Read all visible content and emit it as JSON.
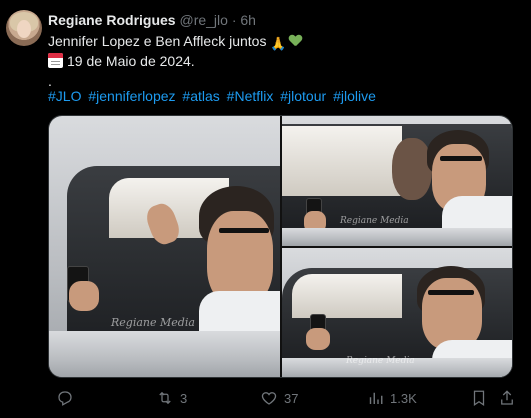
{
  "tweet": {
    "author_name": "Regiane Rodrigues",
    "handle": "@re_jlo",
    "separator": "·",
    "time": "6h",
    "line1": "Jennifer Lopez e Ben Affleck juntos",
    "line1_emoji_pray": "🙏",
    "line2": "19 de Maio de 2024.",
    "line3": ".",
    "hashtags": [
      "#JLO",
      "#jenniferlopez",
      "#atlas",
      "#Netflix",
      "#jlotour",
      "#jlolive"
    ],
    "watermarks": [
      "Regiane Media",
      "Regiane Media",
      "Regiane Media"
    ]
  },
  "actions": {
    "reply_count": "",
    "retweet_count": "3",
    "like_count": "37",
    "views_count": "1.3K"
  },
  "icons": {
    "reply": "reply-icon",
    "retweet": "retweet-icon",
    "like": "heart-icon",
    "views": "views-icon",
    "bookmark": "bookmark-icon",
    "share": "share-icon"
  },
  "colors": {
    "background": "#000000",
    "text": "#e7e9ea",
    "muted": "#71767b",
    "link": "#1d9bf0"
  }
}
